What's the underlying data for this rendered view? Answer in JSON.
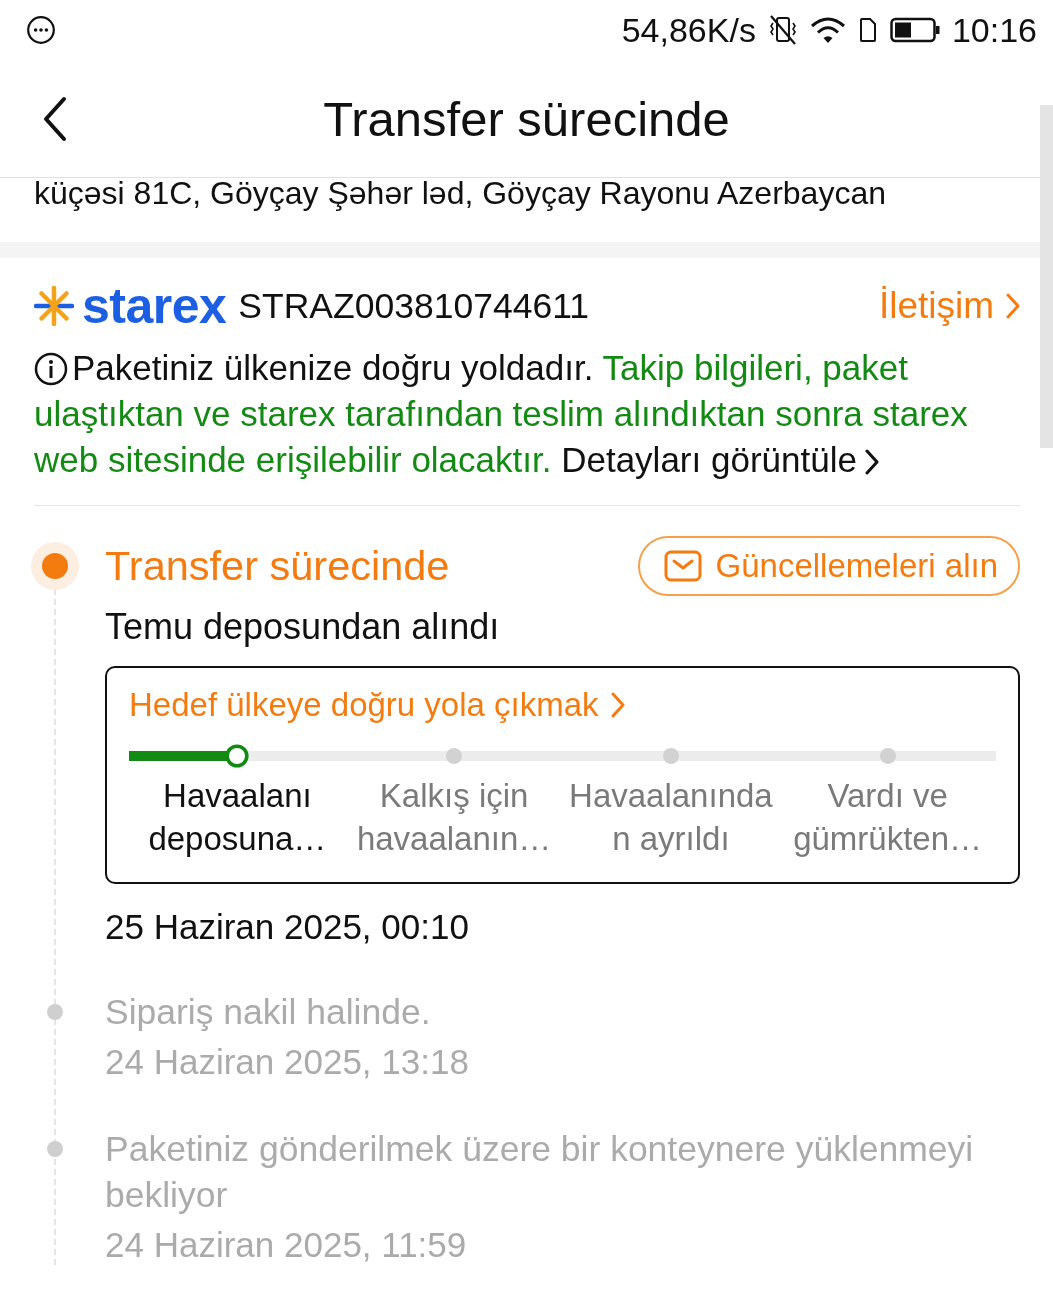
{
  "status_bar": {
    "net_speed": "54,86K/s",
    "time": "10:16"
  },
  "header": {
    "title": "Transfer sürecinde"
  },
  "address": {
    "text": "küçəsi 81C, Göyçay Şəhər ləd, Göyçay Rayonu Azerbaycan"
  },
  "shipment": {
    "logo_text": "starex",
    "tracking_number": "STRAZ003810744611",
    "contact_link": "İletişim",
    "notice": {
      "text": "Paketiniz ülkenize doğru yoldadır.",
      "highlight": "Takip bilgileri, paket ulaştıktan ve starex tarafından teslim alındıktan sonra starex web sitesinde erişilebilir olacaktır.",
      "link": "Detayları görüntüle"
    }
  },
  "timeline": {
    "events": [
      {
        "current": true,
        "title": "Transfer sürecinde",
        "button": "Güncellemeleri alın",
        "description": "Temu deposundan alındı",
        "tracker": {
          "title": "Hedef ülkeye doğru yola çıkmak",
          "level": 0.125,
          "steps": [
            {
              "label": "Havaalanı deposuna…",
              "current": true
            },
            {
              "label": "Kalkış için havaalanın…",
              "current": false
            },
            {
              "label": "Havaalanından ayrıldı",
              "current": false
            },
            {
              "label": "Vardı ve gümrükten…",
              "current": false
            }
          ]
        },
        "date": "25 Haziran 2025, 00:10"
      },
      {
        "current": false,
        "title": "Sipariş nakil halinde.",
        "date": "24 Haziran 2025, 13:18"
      },
      {
        "current": false,
        "title": "Paketiniz gönderilmek üzere bir konteynere yüklenmeyi bekliyor",
        "date": "24 Haziran 2025, 11:59"
      }
    ]
  }
}
